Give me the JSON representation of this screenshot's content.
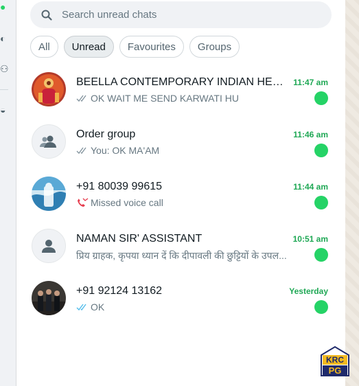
{
  "search": {
    "placeholder": "Search unread chats"
  },
  "filters": [
    {
      "label": "All",
      "active": false
    },
    {
      "label": "Unread",
      "active": true
    },
    {
      "label": "Favourites",
      "active": false
    },
    {
      "label": "Groups",
      "active": false
    }
  ],
  "chats": [
    {
      "name": "BEELLA CONTEMPORARY INDIAN HERITA...",
      "time": "11:47 am",
      "preview": "OK WAIT ME SEND KARWATI HU",
      "status": "double-check-gray",
      "avatar": "photo-goddess"
    },
    {
      "name": "Order group",
      "time": "11:46 am",
      "preview": "You: OK MA'AM",
      "status": "double-check-gray",
      "avatar": "group-icon"
    },
    {
      "name": "+91 80039 99615",
      "time": "11:44 am",
      "preview": "Missed voice call",
      "status": "missed-call",
      "avatar": "photo-water"
    },
    {
      "name": "NAMAN SIR' ASSISTANT",
      "time": "10:51 am",
      "preview": "प्रिय ग्राहक, कृपया ध्यान दें कि दीपावली की छुट्टियों के उपल...",
      "status": "none",
      "avatar": "person-icon"
    },
    {
      "name": "+91 92124 13162",
      "time": "Yesterday",
      "preview": "OK",
      "status": "double-check-blue",
      "avatar": "photo-group"
    }
  ],
  "logo": {
    "text_top": "KRC",
    "text_bottom": "PG"
  },
  "colors": {
    "unread_green": "#25d366",
    "time_green": "#1fa855",
    "read_blue": "#53bdeb",
    "missed_red": "#e63e4f"
  }
}
